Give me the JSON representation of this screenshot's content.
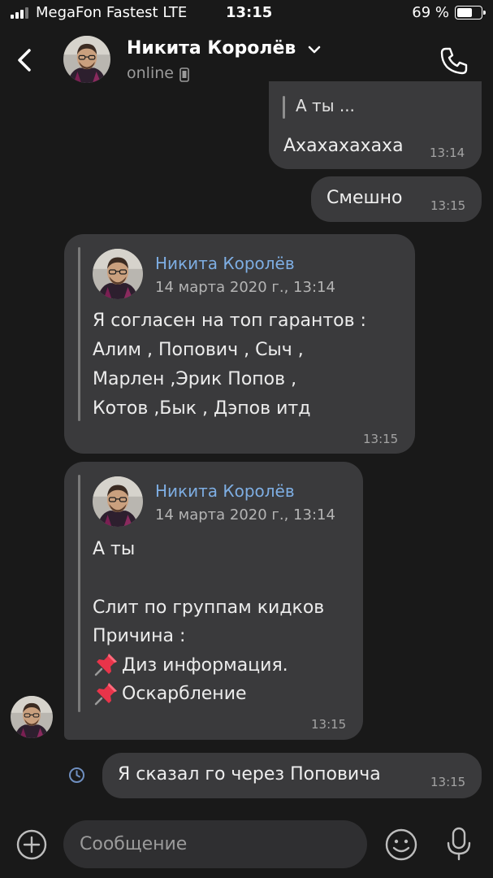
{
  "status_bar": {
    "carrier": "MegaFon Fastest  LTE",
    "time": "13:15",
    "battery": "69 %",
    "battery_level": 0.69
  },
  "header": {
    "contact_name": "Никита Королёв",
    "presence": "online",
    "icons": [
      "back-chevron-icon",
      "chevron-down-icon",
      "phone-icon",
      "mobile-device-icon"
    ]
  },
  "messages": {
    "m1": {
      "quote": "А ты ...",
      "text": "Ахахахахаха",
      "time": "13:14"
    },
    "m2": {
      "text": "Смешно",
      "time": "13:15"
    },
    "m3": {
      "fwd_name": "Никита Королёв",
      "fwd_date": "14 марта 2020 г., 13:14",
      "lines": [
        "Я согласен  на топ гарантов :",
        "Алим , Попович , Сыч ,",
        "Марлен ,Эрик Попов ,",
        "Котов ,Бык , Дэпов итд"
      ],
      "time": "13:15"
    },
    "m4": {
      "fwd_name": "Никита Королёв",
      "fwd_date": "14 марта 2020 г., 13:14",
      "lines": [
        "А ты",
        "",
        "Слит по группам кидков",
        "Причина :",
        "Диз информация.",
        "Оскарбление"
      ],
      "time": "13:15"
    },
    "m5": {
      "text": "Я сказал го через Поповича",
      "time": "13:15",
      "status_icon": "clock-icon"
    }
  },
  "composer": {
    "placeholder": "Сообщение",
    "icons": [
      "plus-icon",
      "emoji-icon",
      "microphone-icon"
    ]
  },
  "colors": {
    "background": "#191919",
    "bubble": "#3a3a3c",
    "forward_name": "#7eaee3",
    "input_field": "#2f2f31"
  }
}
